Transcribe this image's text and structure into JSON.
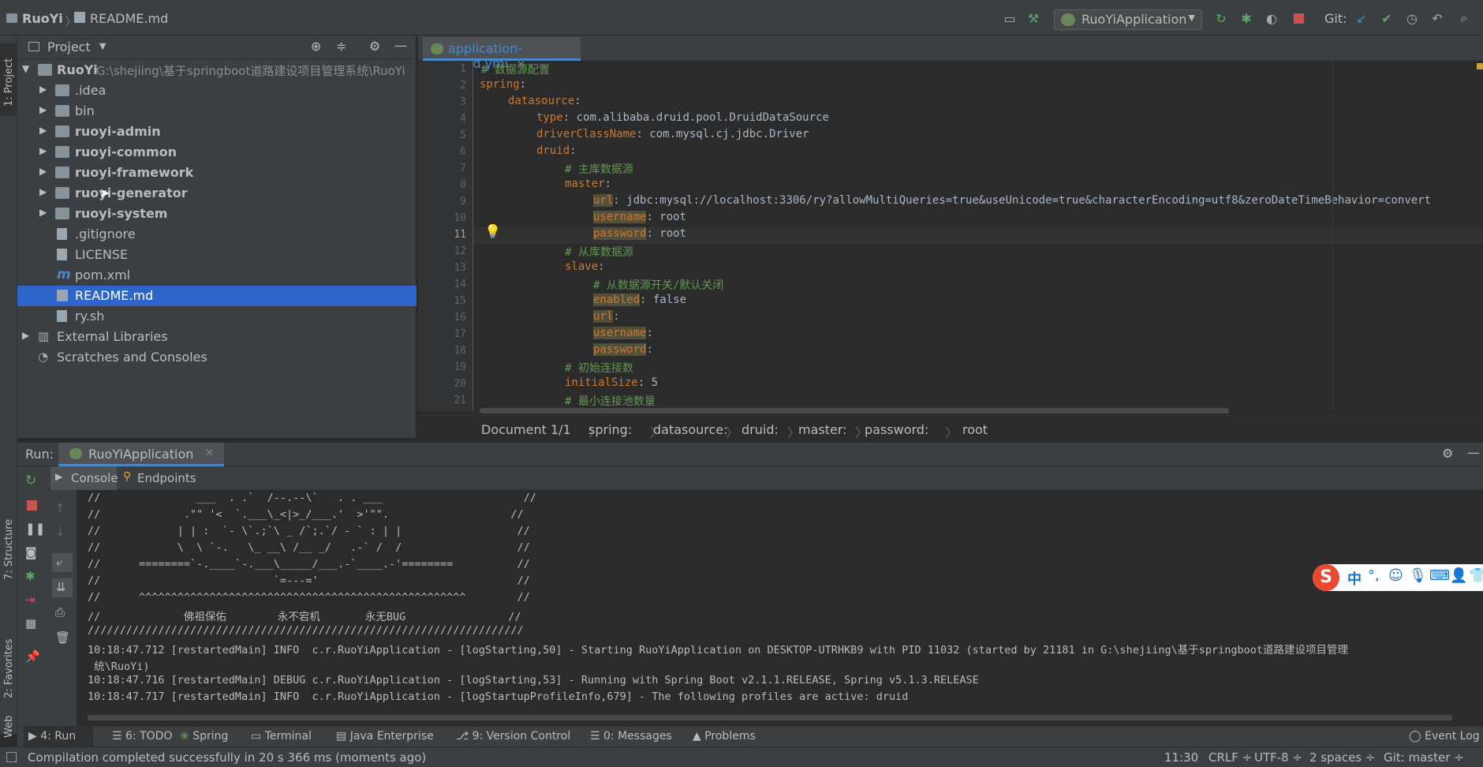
{
  "window": {
    "project_name": "RuoYi",
    "open_file": "README.md"
  },
  "toolbar": {
    "run_config": "RuoYiApplication",
    "git_label": "Git:"
  },
  "left_strip": {
    "project": "1: Project",
    "structure": "7: Structure",
    "favorites": "2: Favorites",
    "web": "Web"
  },
  "project_panel": {
    "title": "Project",
    "root": {
      "name": "RuoYi",
      "path": "G:\\shejiing\\基于springboot道路建设项目管理系统\\RuoYi"
    },
    "items": [
      {
        "label": ".idea",
        "type": "folder"
      },
      {
        "label": "bin",
        "type": "folder"
      },
      {
        "label": "ruoyi-admin",
        "type": "module"
      },
      {
        "label": "ruoyi-common",
        "type": "module"
      },
      {
        "label": "ruoyi-framework",
        "type": "module"
      },
      {
        "label": "ruoyi-generator",
        "type": "module"
      },
      {
        "label": "ruoyi-system",
        "type": "module"
      },
      {
        "label": ".gitignore",
        "type": "file"
      },
      {
        "label": "LICENSE",
        "type": "file"
      },
      {
        "label": "pom.xml",
        "type": "maven"
      },
      {
        "label": "README.md",
        "type": "markdown",
        "selected": true
      },
      {
        "label": "ry.sh",
        "type": "file"
      }
    ],
    "external_libraries": "External Libraries",
    "scratches": "Scratches and Consoles"
  },
  "editor": {
    "tab": "application-druid.yml",
    "lines": [
      "1",
      "2",
      "3",
      "4",
      "5",
      "6",
      "7",
      "8",
      "9",
      "10",
      "11",
      "12",
      "13",
      "14",
      "15",
      "16",
      "17",
      "18",
      "19",
      "20",
      "21"
    ],
    "code": {
      "l1": "# 数据源配置",
      "l2_key": "spring",
      "l3_key": "datasource",
      "l4_key": "type",
      "l4_val": " com.alibaba.druid.pool.DruidDataSource",
      "l5_key": "driverClassName",
      "l5_val": " com.mysql.cj.jdbc.Driver",
      "l6_key": "druid",
      "l7": "# 主库数据源",
      "l8_key": "master",
      "l9_key": "url",
      "l9_val": " jdbc:mysql://localhost:3306/ry?allowMultiQueries=true&useUnicode=true&characterEncoding=utf8&zeroDateTimeBehavior=convert",
      "l10_key": "username",
      "l10_val": " root",
      "l11_key": "password",
      "l11_val": " root",
      "l12": "# 从库数据源",
      "l13_key": "slave",
      "l14": "# 从数据源开关/默认关闭",
      "l15_key": "enabled",
      "l15_val": " false",
      "l16_key": "url",
      "l17_key": "username",
      "l18_key": "password",
      "l19": "# 初始连接数",
      "l20_key": "initialSize",
      "l20_val": " 5",
      "l21": "# 最小连接池数量"
    },
    "breadcrumb": [
      "Document 1/1",
      "spring:",
      "datasource:",
      "druid:",
      "master:",
      "password:",
      "root"
    ]
  },
  "run_panel": {
    "label": "Run:",
    "tab": "RuoYiApplication",
    "console_tab": "Console",
    "endpoints_tab": "Endpoints",
    "console_lines": [
      "//               ___  . .`  /--.--\\`   . . ___                      //",
      "//             .\"\" '<  `.___\\_<|>_/___.'  >'\"\".                   //",
      "//            | | :  `- \\`.;`\\ _ /`;.`/ - ` : | |                  //",
      "//            \\  \\ `-.   \\_ __\\ /__ _/   .-` /  /                  //",
      "//      ========`-.____`-.___\\_____/___.-`____.-'========          //",
      "//                           `=---='                               //",
      "//      ^^^^^^^^^^^^^^^^^^^^^^^^^^^^^^^^^^^^^^^^^^^^^^^^^^^        //",
      "//             佛祖保佑        永不宕机       永无BUG                //",
      "////////////////////////////////////////////////////////////////////",
      "10:18:47.712 [restartedMain] INFO  c.r.RuoYiApplication - [logStarting,50] - Starting RuoYiApplication on DESKTOP-UTRHKB9 with PID 11032 (started by 21181 in G:\\shejiing\\基于springboot道路建设项目管理",
      " 统\\RuoYi)",
      "10:18:47.716 [restartedMain] DEBUG c.r.RuoYiApplication - [logStarting,53] - Running with Spring Boot v2.1.1.RELEASE, Spring v5.1.3.RELEASE",
      "10:18:47.717 [restartedMain] INFO  c.r.RuoYiApplication - [logStartupProfileInfo,679] - The following profiles are active: druid"
    ]
  },
  "bottom_tools": [
    {
      "label": "4: Run"
    },
    {
      "label": "6: TODO"
    },
    {
      "label": "Spring"
    },
    {
      "label": "Terminal"
    },
    {
      "label": "Java Enterprise"
    },
    {
      "label": "9: Version Control"
    },
    {
      "label": "0: Messages"
    },
    {
      "label": "Problems"
    },
    {
      "label": "Event Log"
    }
  ],
  "status": {
    "message": "Compilation completed successfully in 20 s 366 ms (moments ago)",
    "position": "11:30",
    "line_sep": "CRLF ÷",
    "encoding": "UTF-8 ÷",
    "indent": "2 spaces ÷",
    "git": "Git: master ÷"
  },
  "ime": {
    "lang": "中",
    "punct": "°,"
  },
  "colors": {
    "accent": "#4a88c7",
    "keyword": "#cc7832",
    "comment": "#629755",
    "selection": "#2f65ca"
  }
}
